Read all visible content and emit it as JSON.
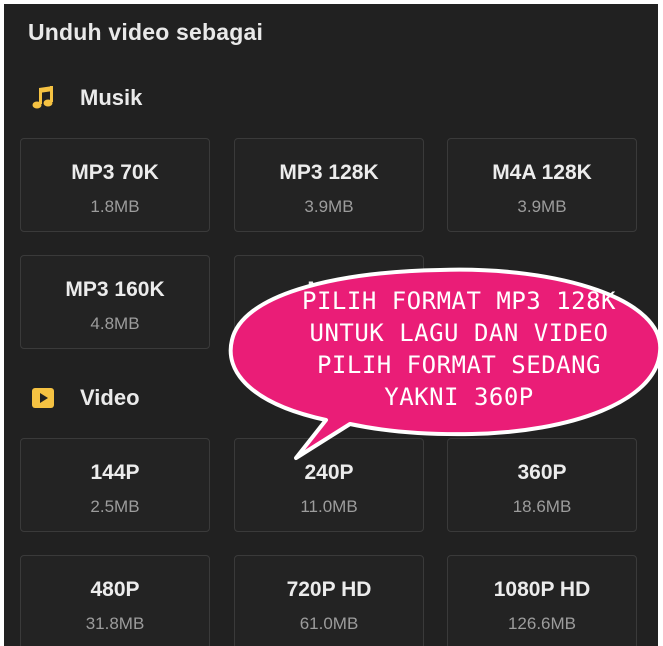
{
  "dialog": {
    "title": "Unduh video sebagai"
  },
  "music_section": {
    "label": "Musik",
    "icon": "music-note-icon",
    "icon_color": "#f5c242",
    "options": [
      {
        "format": "MP3 70K",
        "size": "1.8MB"
      },
      {
        "format": "MP3 128K",
        "size": "3.9MB"
      },
      {
        "format": "M4A 128K",
        "size": "3.9MB"
      },
      {
        "format": "MP3 160K",
        "size": "4.8MB"
      },
      {
        "format": "MP3",
        "size": ""
      }
    ]
  },
  "video_section": {
    "label": "Video",
    "icon": "play-icon",
    "icon_color": "#f5c242",
    "options": [
      {
        "format": "144P",
        "size": "2.5MB"
      },
      {
        "format": "240P",
        "size": "11.0MB"
      },
      {
        "format": "360P",
        "size": "18.6MB"
      },
      {
        "format": "480P",
        "size": "31.8MB"
      },
      {
        "format": "720P HD",
        "size": "61.0MB"
      },
      {
        "format": "1080P HD",
        "size": "126.6MB"
      }
    ]
  },
  "annotation": {
    "bubble_color": "#ea1d77",
    "lines": [
      "PILIH FORMAT MP3 128K",
      "UNTUK LAGU DAN VIDEO",
      "PILIH FORMAT SEDANG",
      "YAKNI 360P"
    ]
  }
}
